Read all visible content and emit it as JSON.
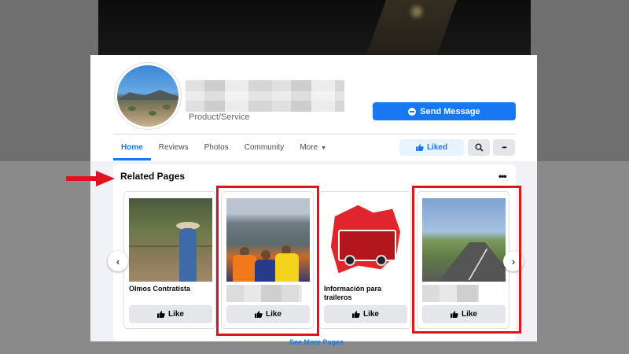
{
  "page": {
    "category": "Product/Service",
    "send_message_label": "Send Message",
    "liked_label": "Liked"
  },
  "tabs": [
    {
      "label": "Home"
    },
    {
      "label": "Reviews"
    },
    {
      "label": "Photos"
    },
    {
      "label": "Community"
    },
    {
      "label": "More"
    }
  ],
  "related": {
    "title": "Related Pages",
    "more_glyph": "•••",
    "see_more": "See More Pages",
    "cards": [
      {
        "label": "Olmos Contratista",
        "like": "Like"
      },
      {
        "label": "",
        "like": "Like"
      },
      {
        "label": "Información para traileros",
        "like": "Like"
      },
      {
        "label": "",
        "like": "Like"
      }
    ]
  },
  "icons": {
    "search": "⌕",
    "ellipsis": "•••",
    "prev": "‹",
    "next": "›",
    "caret": "▼"
  },
  "colors": {
    "accent": "#1877f2",
    "highlight": "#e0141e"
  }
}
